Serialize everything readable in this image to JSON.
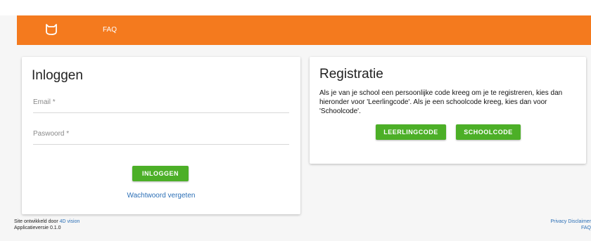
{
  "nav": {
    "logo_icon": "cat-logo-icon",
    "faq": "FAQ",
    "color": "#f47a1e"
  },
  "login": {
    "title": "Inloggen",
    "email_label": "Email *",
    "password_label": "Paswoord *",
    "submit_label": "INLOGGEN",
    "forgot_label": "Wachtwoord vergeten"
  },
  "registration": {
    "title": "Registratie",
    "text": "Als je van je school een persoonlijke code kreeg om je te registreren, kies dan hieronder voor 'Leerlingcode'. Als je een schoolcode kreeg, kies dan voor 'Schoolcode'.",
    "student_button": "LEERLINGCODE",
    "school_button": "SCHOOLCODE"
  },
  "footer": {
    "developed_by": "Site ontwikkeld door ",
    "developer_link": "4D vision",
    "version": "Applicatieversie 0.1.0",
    "privacy_link": "Privacy Disclaimer",
    "faq_link": "FAQ"
  },
  "colors": {
    "accent_green": "#4caf27",
    "link_blue": "#2b6fb6"
  }
}
